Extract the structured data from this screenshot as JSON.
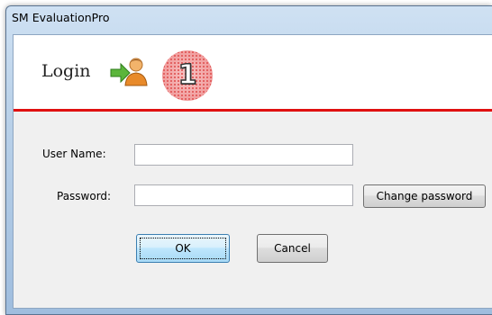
{
  "window": {
    "title": "SM EvaluationPro"
  },
  "header": {
    "title": "Login",
    "icon": "user-login-icon",
    "step_number": "1"
  },
  "form": {
    "username_label": "User Name:",
    "username_value": "",
    "password_label": "Password:",
    "password_value": "",
    "change_password_label": "Change password",
    "ok_label": "OK",
    "cancel_label": "Cancel"
  },
  "colors": {
    "header_underline": "#e01010",
    "dialog_background": "#f0f0f0",
    "badge_fill": "#f3a0a0"
  }
}
